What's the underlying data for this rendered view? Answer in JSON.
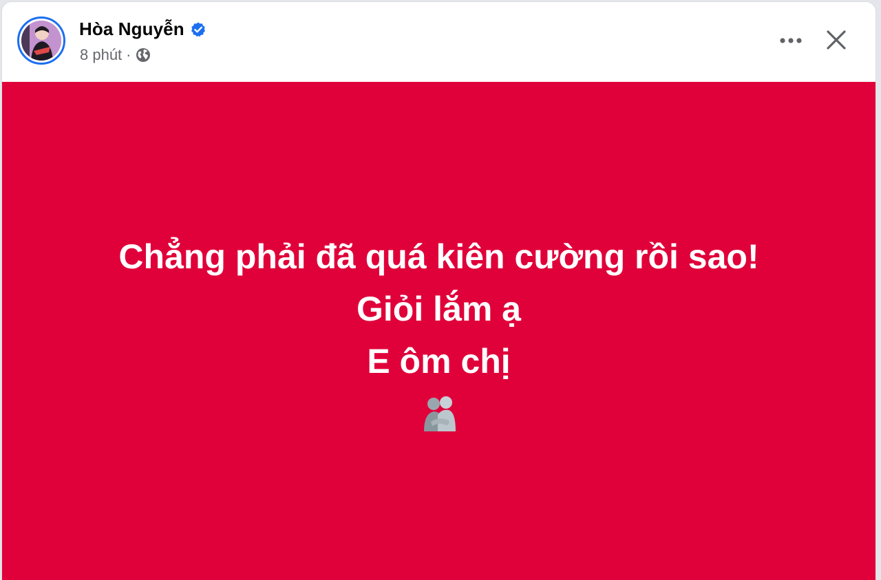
{
  "post": {
    "author": "Hòa Nguyễn",
    "time": "8 phút",
    "separator": "·",
    "privacy_icon": "globe-icon",
    "verified_icon": "verified-badge-icon",
    "background_color": "#e0003a",
    "text_color": "#ffffff",
    "lines": [
      "Chẳng phải đã quá kiên cường rồi sao!",
      "Giỏi lắm ạ",
      "E ôm chị"
    ],
    "emoji": "🫂"
  },
  "header": {
    "more_icon": "more-options-icon",
    "close_icon": "close-icon",
    "accent": "#1b6ff0"
  }
}
